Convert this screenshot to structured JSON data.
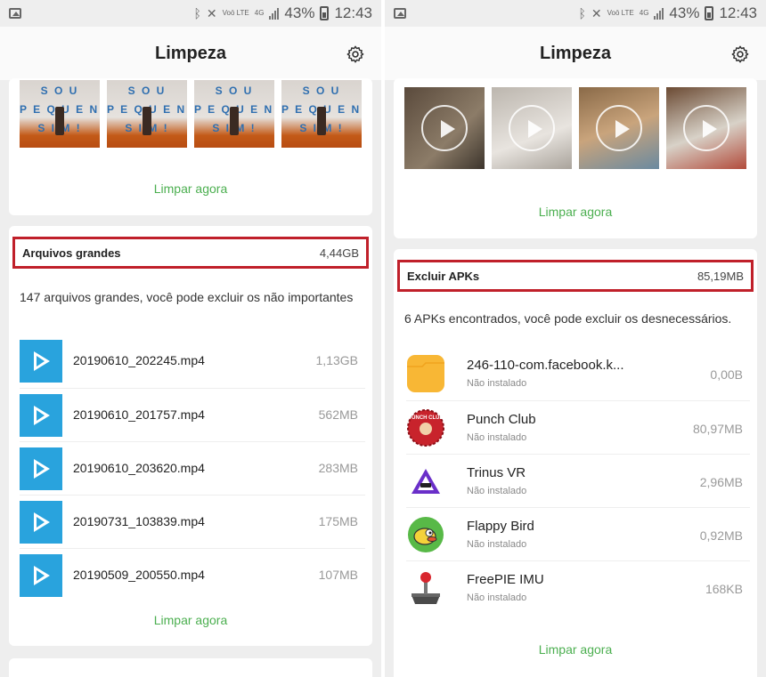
{
  "status_bar": {
    "volte": "Voō LTE",
    "network": "4G",
    "battery_percent": "43%",
    "time": "12:43",
    "icons": [
      "image-icon",
      "bluetooth-icon",
      "mute-icon",
      "signal-icon",
      "battery-icon"
    ]
  },
  "left_screen": {
    "title": "Limpeza",
    "photos_card": {
      "thumbnail_text": "S O U\nP E Q U E N O\nS I M !",
      "clean_label": "Limpar agora"
    },
    "large_files": {
      "title": "Arquivos grandes",
      "size": "4,44GB",
      "description": "147 arquivos grandes, você pode excluir os não importantes",
      "files": [
        {
          "name": "20190610_202245.mp4",
          "size": "1,13GB"
        },
        {
          "name": "20190610_201757.mp4",
          "size": "562MB"
        },
        {
          "name": "20190610_203620.mp4",
          "size": "283MB"
        },
        {
          "name": "20190731_103839.mp4",
          "size": "175MB"
        },
        {
          "name": "20190509_200550.mp4",
          "size": "107MB"
        }
      ],
      "clean_label": "Limpar agora"
    }
  },
  "right_screen": {
    "title": "Limpeza",
    "videos_card": {
      "clean_label": "Limpar agora"
    },
    "apks": {
      "title": "Excluir APKs",
      "size": "85,19MB",
      "description": "6 APKs encontrados, você pode excluir os desnecessários.",
      "items": [
        {
          "name": "246-110-com.facebook.k...",
          "status": "Não instalado",
          "size": "0,00B",
          "icon": "folder-icon"
        },
        {
          "name": "Punch Club",
          "status": "Não instalado",
          "size": "80,97MB",
          "icon": "punch-club-icon",
          "icon_text": "PUNCH CLUB"
        },
        {
          "name": "Trinus VR",
          "status": "Não instalado",
          "size": "2,96MB",
          "icon": "trinus-vr-icon"
        },
        {
          "name": "Flappy Bird",
          "status": "Não instalado",
          "size": "0,92MB",
          "icon": "flappy-bird-icon"
        },
        {
          "name": "FreePIE IMU",
          "status": "Não instalado",
          "size": "168KB",
          "icon": "joystick-icon"
        }
      ],
      "clean_label": "Limpar agora"
    }
  },
  "colors": {
    "accent_green": "#4caf50",
    "highlight_red": "#c0202a",
    "video_icon_blue": "#29a3dd"
  }
}
